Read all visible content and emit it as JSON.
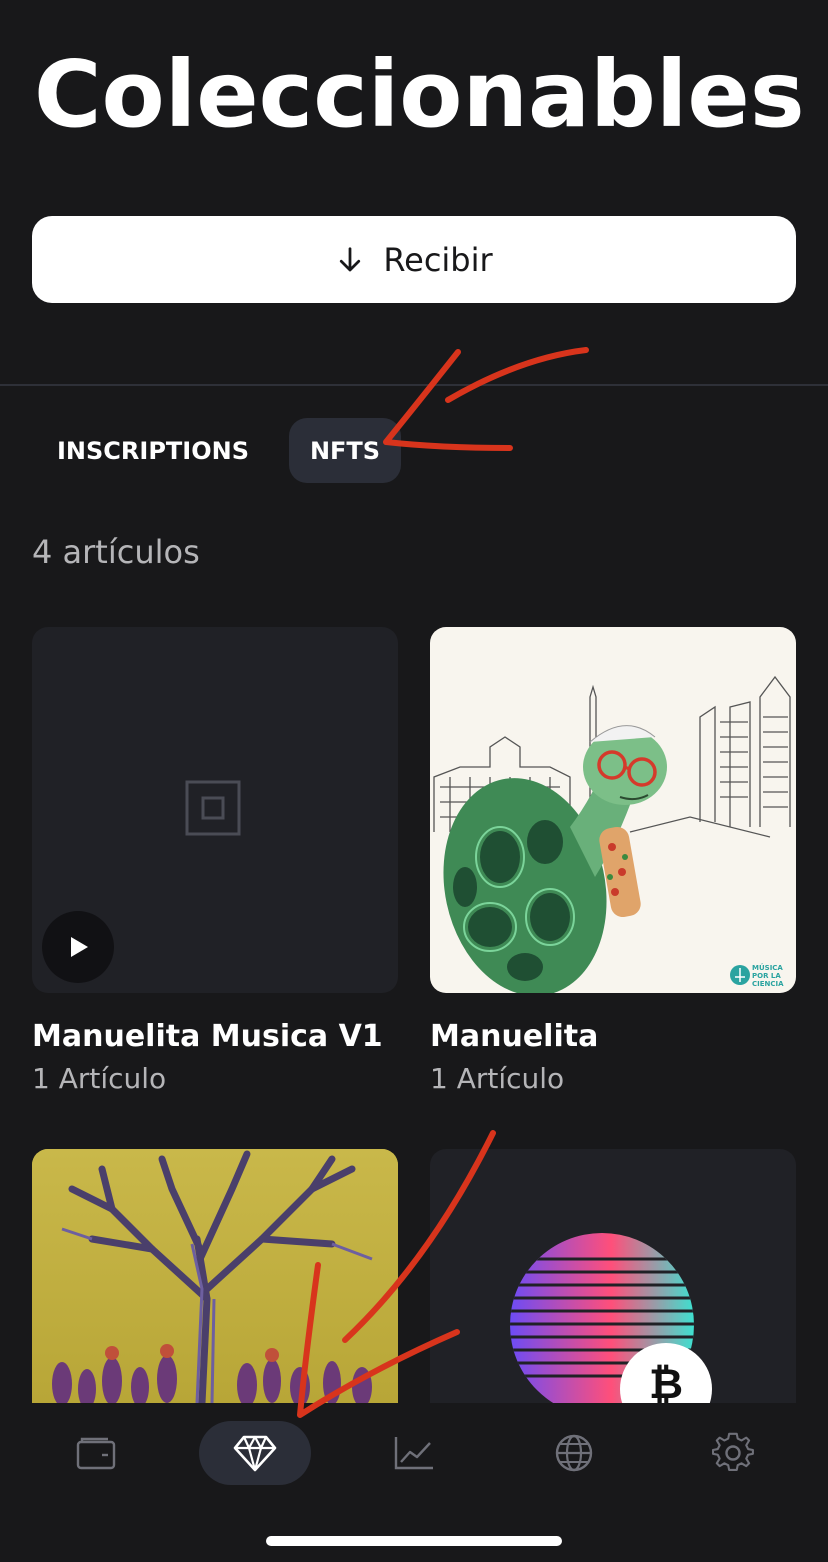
{
  "header": {
    "title": "Coleccionables"
  },
  "actions": {
    "receive_label": "Recibir"
  },
  "tabs": [
    {
      "label": "INSCRIPTIONS",
      "active": false
    },
    {
      "label": "NFTS",
      "active": true
    }
  ],
  "collection": {
    "count_label": "4 artículos",
    "items": [
      {
        "title": "Manuelita Musica V1",
        "subtitle": "1 Artículo",
        "media": "audio-placeholder"
      },
      {
        "title": "Manuelita",
        "subtitle": "1 Artículo",
        "media": "turtle-illustration",
        "watermark": "MÚSICA POR LA CIENCIA"
      },
      {
        "title": "",
        "subtitle": "",
        "media": "tree-painting"
      },
      {
        "title": "",
        "subtitle": "",
        "media": "bitcoin-sunset-art",
        "badge_glyph": "₿"
      }
    ]
  },
  "bottom_nav": [
    {
      "icon": "wallet-icon",
      "active": false
    },
    {
      "icon": "diamond-icon",
      "active": true
    },
    {
      "icon": "chart-icon",
      "active": false
    },
    {
      "icon": "globe-icon",
      "active": false
    },
    {
      "icon": "settings-icon",
      "active": false
    }
  ],
  "colors": {
    "background": "#18181a",
    "surface": "#202126",
    "active_pill": "#2b2e38",
    "annotation_red": "#d8341c",
    "muted_text": "#b5b5b8"
  }
}
